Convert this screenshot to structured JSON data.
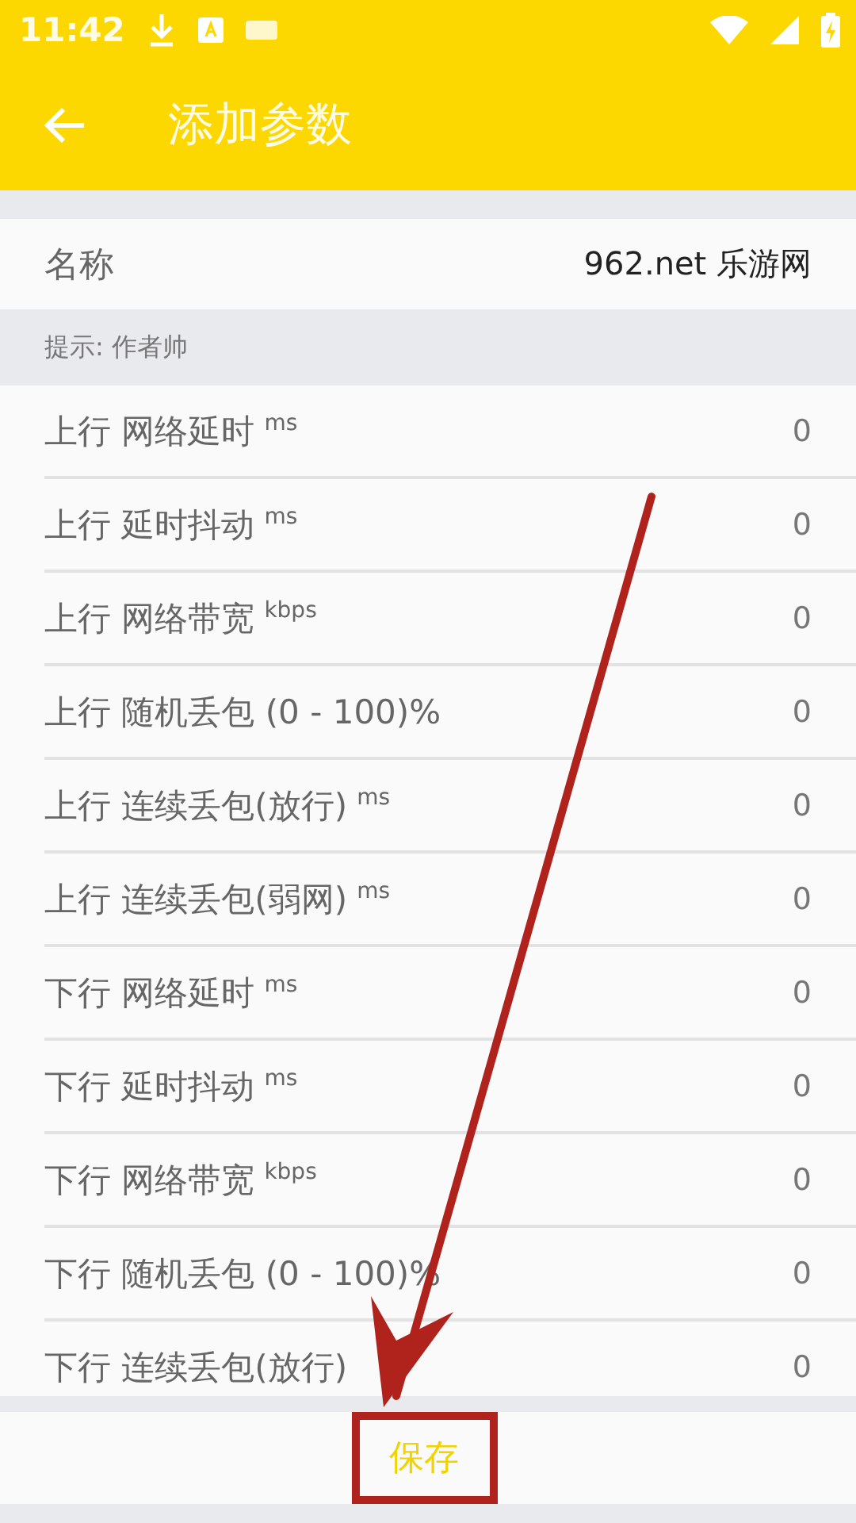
{
  "status_bar": {
    "time": "11:42"
  },
  "toolbar": {
    "title": "添加参数"
  },
  "name_field": {
    "label": "名称",
    "value": "962.net 乐游网"
  },
  "hint": "提示: 作者帅",
  "params": [
    {
      "label": "上行 网络延时",
      "unit": "ms",
      "value": "0"
    },
    {
      "label": "上行 延时抖动",
      "unit": "ms",
      "value": "0"
    },
    {
      "label": "上行 网络带宽",
      "unit": "kbps",
      "value": "0"
    },
    {
      "label": "上行 随机丢包 (0 - 100)%",
      "value": "0"
    },
    {
      "label": "上行 连续丢包(放行)",
      "unit": "ms",
      "value": "0"
    },
    {
      "label": "上行 连续丢包(弱网)",
      "unit": "ms",
      "value": "0"
    },
    {
      "label": "下行 网络延时",
      "unit": "ms",
      "value": "0"
    },
    {
      "label": "下行 延时抖动",
      "unit": "ms",
      "value": "0"
    },
    {
      "label": "下行 网络带宽",
      "unit": "kbps",
      "value": "0"
    },
    {
      "label": "下行 随机丢包 (0 - 100)%",
      "value": "0"
    },
    {
      "label": "下行 连续丢包(放行)",
      "value": "0"
    }
  ],
  "save_button": "保存"
}
